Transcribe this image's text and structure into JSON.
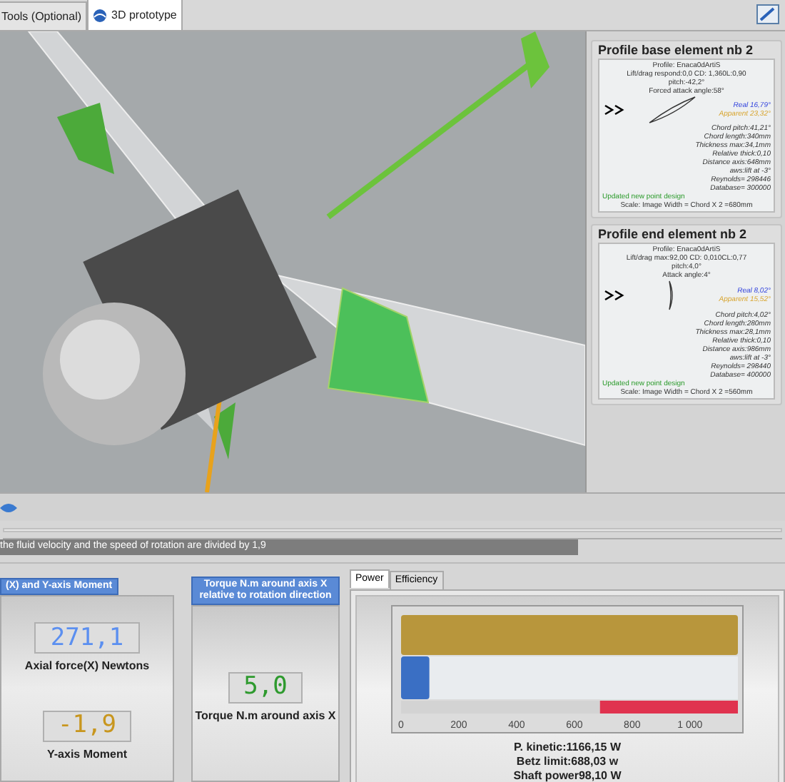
{
  "tabs": [
    {
      "label": "Tools (Optional)",
      "selected": false
    },
    {
      "label": "3D prototype",
      "selected": true
    }
  ],
  "profiles": [
    {
      "title": "Profile base element nb 2",
      "header_lines": [
        "Profile: Enaca0dArtiS",
        "Lift/drag respond:0,0 CD: 1,360L:0,90",
        "pitch:-42,2°",
        "Forced attack angle:58°"
      ],
      "real": "Real 16,79°",
      "apparent": "Apparent 23,32°",
      "details": [
        "Chord pitch:41,21°",
        "Chord length:340mm",
        "Thickness max:34,1mm",
        "Relative thick:0,10",
        "Distance axis:648mm",
        "aws:lift at -3°",
        "Reynolds= 298446",
        "Database= 300000"
      ],
      "note": "Updated new point design",
      "scale": "Scale: Image Width = Chord X 2 =680mm"
    },
    {
      "title": "Profile end element nb 2",
      "header_lines": [
        "Profile: Enaca0dArtiS",
        "Lift/drag max:92,00 CD: 0,010CL:0,77",
        "pitch:4,0°",
        "Attack angle:4°"
      ],
      "real": "Real 8,02°",
      "apparent": "Apparent 15,52°",
      "details": [
        "Chord pitch:4,02°",
        "Chord length:280mm",
        "Thickness max:28,1mm",
        "Relative thick:0,10",
        "Distance axis:986mm",
        "aws:lift at -3°",
        "Reynolds= 298440",
        "Database= 400000"
      ],
      "note": "Updated new point design",
      "scale": "Scale: Image Width = Chord X 2 =560mm"
    }
  ],
  "status_text": "the fluid velocity and the speed of rotation are divided by 1,9",
  "groups": [
    {
      "title": "(X) and Y-axis Moment",
      "displays": [
        {
          "value": "271,1",
          "label": "Axial force(X) Newtons",
          "color": "#5b8ff0"
        },
        {
          "value": "-1,9",
          "label": "Y-axis Moment",
          "color": "#c8961e"
        }
      ]
    },
    {
      "title": "Torque N.m around axis X relative to rotation direction",
      "displays": [
        {
          "value": "5,0",
          "label": "Torque N.m around axis X",
          "color": "#2e9a2e"
        }
      ]
    }
  ],
  "power_tabs": [
    {
      "label": "Power",
      "selected": true
    },
    {
      "label": "Efficiency",
      "selected": false
    }
  ],
  "power_gauge": {
    "scale_labels": [
      "0",
      "200",
      "400",
      "600",
      "800",
      "1 000"
    ],
    "meters": [
      {
        "kind": "kinetic",
        "level": 1.0
      },
      {
        "kind": "shaft",
        "level": 0.084
      },
      {
        "kind": "betz",
        "level": 0.59
      }
    ]
  },
  "readings": [
    "P. kinetic:1166,15 W",
    "Betz limit:688,03 w",
    "Shaft power98,10 W"
  ]
}
